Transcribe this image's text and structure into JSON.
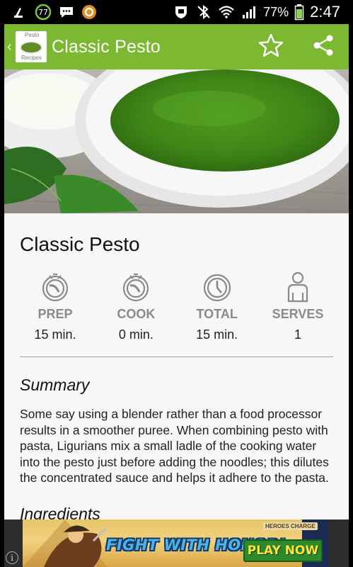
{
  "status_bar": {
    "notification_badge": "77",
    "battery_percent": "77%",
    "time": "2:47"
  },
  "app_bar": {
    "title": "Classic Pesto",
    "logo_text_top": "Pesto",
    "logo_text_bottom": "Recipes",
    "accent_color": "#7cb832"
  },
  "recipe": {
    "title": "Classic Pesto",
    "stats": [
      {
        "label": "PREP",
        "value": "15 min.",
        "icon": "stopwatch-icon"
      },
      {
        "label": "COOK",
        "value": "0 min.",
        "icon": "stopwatch-icon"
      },
      {
        "label": "TOTAL",
        "value": "15 min.",
        "icon": "clock-icon"
      },
      {
        "label": "SERVES",
        "value": "1",
        "icon": "person-icon"
      }
    ],
    "summary_title": "Summary",
    "summary_text": "Some say using a blender rather than a food processor results in a smoother puree. When combining pesto with pasta, Ligurians mix a small ladle of the cooking water into the pesto just before adding the noodles; this dilutes the concentrated sauce and helps it adhere to the pasta.",
    "next_section_title": "Ingredients"
  },
  "ad": {
    "brand": "HEROES CHARGE",
    "headline": "FIGHT WITH HONOR!",
    "cta": "PLAY NOW",
    "info": "i"
  }
}
